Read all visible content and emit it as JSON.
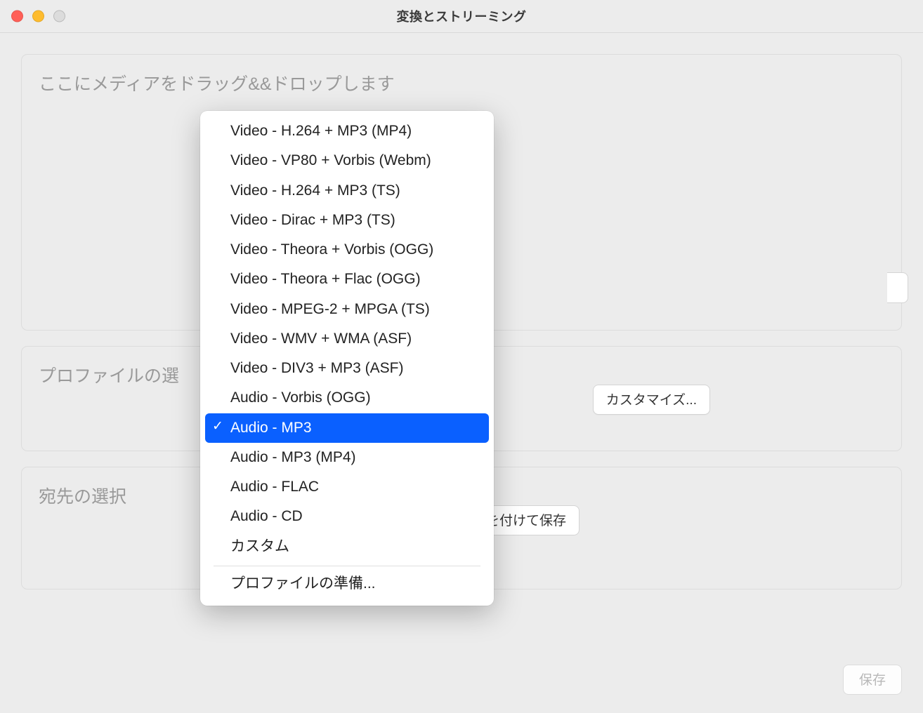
{
  "window": {
    "title": "変換とストリーミング"
  },
  "dropzone": {
    "title": "ここにメディアをドラッグ&&ドロップします"
  },
  "profile_panel": {
    "title": "プロファイルの選",
    "customize_label": "カスタマイズ..."
  },
  "destination_panel": {
    "title": "宛先の選択",
    "save_as_suffix": "を付けて保存"
  },
  "save_button": "保存",
  "dropdown": {
    "items": [
      "Video - H.264 + MP3 (MP4)",
      "Video - VP80 + Vorbis (Webm)",
      "Video - H.264 + MP3 (TS)",
      "Video - Dirac + MP3 (TS)",
      "Video - Theora + Vorbis (OGG)",
      "Video - Theora + Flac (OGG)",
      "Video - MPEG-2 + MPGA (TS)",
      "Video - WMV + WMA (ASF)",
      "Video - DIV3 + MP3 (ASF)",
      "Audio - Vorbis (OGG)",
      "Audio - MP3",
      "Audio - MP3 (MP4)",
      "Audio - FLAC",
      "Audio - CD",
      "カスタム"
    ],
    "selected_index": 10,
    "footer": "プロファイルの準備..."
  }
}
